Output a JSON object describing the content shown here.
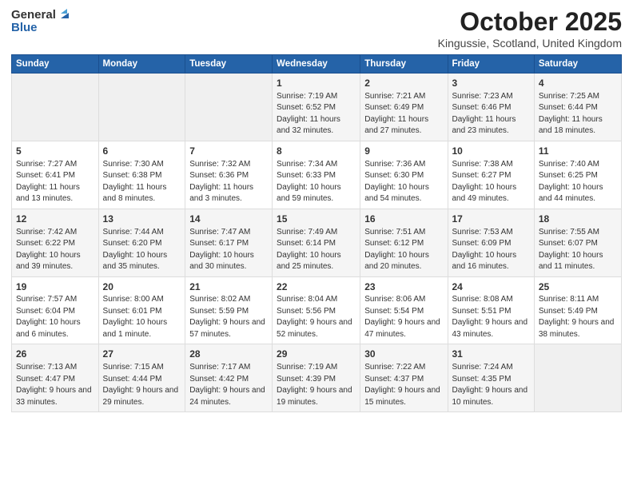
{
  "header": {
    "logo_general": "General",
    "logo_blue": "Blue",
    "month_title": "October 2025",
    "location": "Kingussie, Scotland, United Kingdom"
  },
  "weekdays": [
    "Sunday",
    "Monday",
    "Tuesday",
    "Wednesday",
    "Thursday",
    "Friday",
    "Saturday"
  ],
  "weeks": [
    [
      {
        "day": "",
        "sunrise": "",
        "sunset": "",
        "daylight": ""
      },
      {
        "day": "",
        "sunrise": "",
        "sunset": "",
        "daylight": ""
      },
      {
        "day": "",
        "sunrise": "",
        "sunset": "",
        "daylight": ""
      },
      {
        "day": "1",
        "sunrise": "Sunrise: 7:19 AM",
        "sunset": "Sunset: 6:52 PM",
        "daylight": "Daylight: 11 hours and 32 minutes."
      },
      {
        "day": "2",
        "sunrise": "Sunrise: 7:21 AM",
        "sunset": "Sunset: 6:49 PM",
        "daylight": "Daylight: 11 hours and 27 minutes."
      },
      {
        "day": "3",
        "sunrise": "Sunrise: 7:23 AM",
        "sunset": "Sunset: 6:46 PM",
        "daylight": "Daylight: 11 hours and 23 minutes."
      },
      {
        "day": "4",
        "sunrise": "Sunrise: 7:25 AM",
        "sunset": "Sunset: 6:44 PM",
        "daylight": "Daylight: 11 hours and 18 minutes."
      }
    ],
    [
      {
        "day": "5",
        "sunrise": "Sunrise: 7:27 AM",
        "sunset": "Sunset: 6:41 PM",
        "daylight": "Daylight: 11 hours and 13 minutes."
      },
      {
        "day": "6",
        "sunrise": "Sunrise: 7:30 AM",
        "sunset": "Sunset: 6:38 PM",
        "daylight": "Daylight: 11 hours and 8 minutes."
      },
      {
        "day": "7",
        "sunrise": "Sunrise: 7:32 AM",
        "sunset": "Sunset: 6:36 PM",
        "daylight": "Daylight: 11 hours and 3 minutes."
      },
      {
        "day": "8",
        "sunrise": "Sunrise: 7:34 AM",
        "sunset": "Sunset: 6:33 PM",
        "daylight": "Daylight: 10 hours and 59 minutes."
      },
      {
        "day": "9",
        "sunrise": "Sunrise: 7:36 AM",
        "sunset": "Sunset: 6:30 PM",
        "daylight": "Daylight: 10 hours and 54 minutes."
      },
      {
        "day": "10",
        "sunrise": "Sunrise: 7:38 AM",
        "sunset": "Sunset: 6:27 PM",
        "daylight": "Daylight: 10 hours and 49 minutes."
      },
      {
        "day": "11",
        "sunrise": "Sunrise: 7:40 AM",
        "sunset": "Sunset: 6:25 PM",
        "daylight": "Daylight: 10 hours and 44 minutes."
      }
    ],
    [
      {
        "day": "12",
        "sunrise": "Sunrise: 7:42 AM",
        "sunset": "Sunset: 6:22 PM",
        "daylight": "Daylight: 10 hours and 39 minutes."
      },
      {
        "day": "13",
        "sunrise": "Sunrise: 7:44 AM",
        "sunset": "Sunset: 6:20 PM",
        "daylight": "Daylight: 10 hours and 35 minutes."
      },
      {
        "day": "14",
        "sunrise": "Sunrise: 7:47 AM",
        "sunset": "Sunset: 6:17 PM",
        "daylight": "Daylight: 10 hours and 30 minutes."
      },
      {
        "day": "15",
        "sunrise": "Sunrise: 7:49 AM",
        "sunset": "Sunset: 6:14 PM",
        "daylight": "Daylight: 10 hours and 25 minutes."
      },
      {
        "day": "16",
        "sunrise": "Sunrise: 7:51 AM",
        "sunset": "Sunset: 6:12 PM",
        "daylight": "Daylight: 10 hours and 20 minutes."
      },
      {
        "day": "17",
        "sunrise": "Sunrise: 7:53 AM",
        "sunset": "Sunset: 6:09 PM",
        "daylight": "Daylight: 10 hours and 16 minutes."
      },
      {
        "day": "18",
        "sunrise": "Sunrise: 7:55 AM",
        "sunset": "Sunset: 6:07 PM",
        "daylight": "Daylight: 10 hours and 11 minutes."
      }
    ],
    [
      {
        "day": "19",
        "sunrise": "Sunrise: 7:57 AM",
        "sunset": "Sunset: 6:04 PM",
        "daylight": "Daylight: 10 hours and 6 minutes."
      },
      {
        "day": "20",
        "sunrise": "Sunrise: 8:00 AM",
        "sunset": "Sunset: 6:01 PM",
        "daylight": "Daylight: 10 hours and 1 minute."
      },
      {
        "day": "21",
        "sunrise": "Sunrise: 8:02 AM",
        "sunset": "Sunset: 5:59 PM",
        "daylight": "Daylight: 9 hours and 57 minutes."
      },
      {
        "day": "22",
        "sunrise": "Sunrise: 8:04 AM",
        "sunset": "Sunset: 5:56 PM",
        "daylight": "Daylight: 9 hours and 52 minutes."
      },
      {
        "day": "23",
        "sunrise": "Sunrise: 8:06 AM",
        "sunset": "Sunset: 5:54 PM",
        "daylight": "Daylight: 9 hours and 47 minutes."
      },
      {
        "day": "24",
        "sunrise": "Sunrise: 8:08 AM",
        "sunset": "Sunset: 5:51 PM",
        "daylight": "Daylight: 9 hours and 43 minutes."
      },
      {
        "day": "25",
        "sunrise": "Sunrise: 8:11 AM",
        "sunset": "Sunset: 5:49 PM",
        "daylight": "Daylight: 9 hours and 38 minutes."
      }
    ],
    [
      {
        "day": "26",
        "sunrise": "Sunrise: 7:13 AM",
        "sunset": "Sunset: 4:47 PM",
        "daylight": "Daylight: 9 hours and 33 minutes."
      },
      {
        "day": "27",
        "sunrise": "Sunrise: 7:15 AM",
        "sunset": "Sunset: 4:44 PM",
        "daylight": "Daylight: 9 hours and 29 minutes."
      },
      {
        "day": "28",
        "sunrise": "Sunrise: 7:17 AM",
        "sunset": "Sunset: 4:42 PM",
        "daylight": "Daylight: 9 hours and 24 minutes."
      },
      {
        "day": "29",
        "sunrise": "Sunrise: 7:19 AM",
        "sunset": "Sunset: 4:39 PM",
        "daylight": "Daylight: 9 hours and 19 minutes."
      },
      {
        "day": "30",
        "sunrise": "Sunrise: 7:22 AM",
        "sunset": "Sunset: 4:37 PM",
        "daylight": "Daylight: 9 hours and 15 minutes."
      },
      {
        "day": "31",
        "sunrise": "Sunrise: 7:24 AM",
        "sunset": "Sunset: 4:35 PM",
        "daylight": "Daylight: 9 hours and 10 minutes."
      },
      {
        "day": "",
        "sunrise": "",
        "sunset": "",
        "daylight": ""
      }
    ]
  ]
}
